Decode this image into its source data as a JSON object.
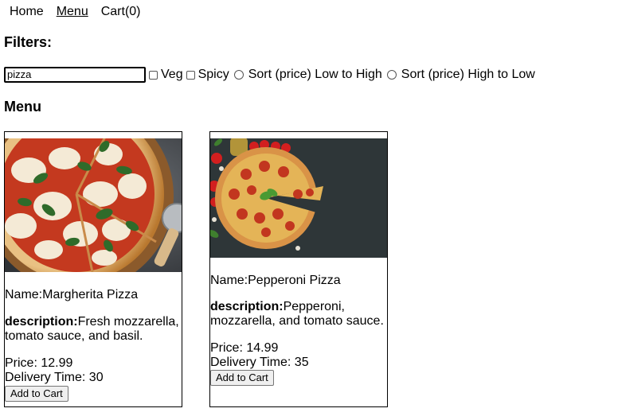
{
  "nav": {
    "items": [
      "Home",
      "Menu",
      "Cart(0)"
    ]
  },
  "filters": {
    "title": "Filters:",
    "search_value": "pizza",
    "veg_label": "Veg",
    "spicy_label": "Spicy",
    "sort_low_label": "Sort (price) Low to High",
    "sort_high_label": "Sort (price) High to Low"
  },
  "menu": {
    "title": "Menu",
    "items": [
      {
        "name_prefix": "Name:",
        "name": "Margherita Pizza",
        "desc_label": "description:",
        "desc": "Fresh mozzarella, tomato sauce, and basil.",
        "price_prefix": "Price: ",
        "price": "12.99",
        "delivery_prefix": "Delivery Time: ",
        "delivery": "30",
        "button": "Add to Cart",
        "image_icon": "margherita-pizza-photo"
      },
      {
        "name_prefix": "Name:",
        "name": "Pepperoni Pizza",
        "desc_label": "description:",
        "desc": "Pepperoni, mozzarella, and tomato sauce.",
        "price_prefix": "Price: ",
        "price": "14.99",
        "delivery_prefix": "Delivery Time: ",
        "delivery": "35",
        "button": "Add to Cart",
        "image_icon": "pepperoni-pizza-photo"
      }
    ]
  },
  "colors": {
    "text": "#000000",
    "border": "#000000",
    "button_bg": "#efefef"
  }
}
